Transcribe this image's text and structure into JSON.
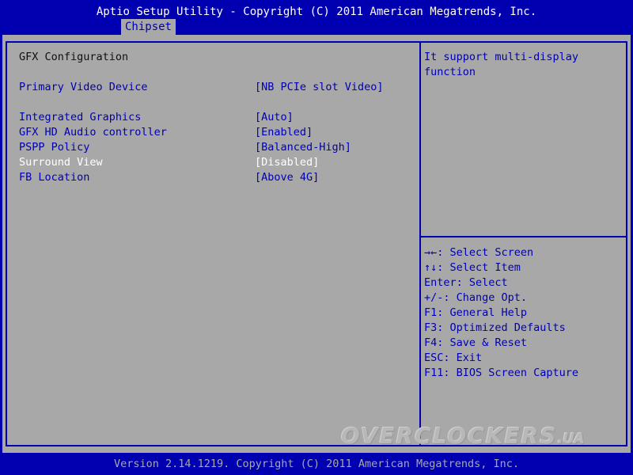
{
  "window": {
    "title": "Aptio Setup Utility - Copyright (C) 2011 American Megatrends, Inc.",
    "active_tab": "Chipset",
    "footer": "Version 2.14.1219. Copyright (C) 2011 American Megatrends, Inc."
  },
  "main": {
    "section_title": "GFX Configuration",
    "settings": [
      {
        "label": "Primary Video Device",
        "value": "[NB PCIe slot Video]",
        "selected": true
      },
      {
        "label": "Integrated Graphics",
        "value": "[Auto]"
      },
      {
        "label": "GFX HD Audio controller",
        "value": "[Enabled]"
      },
      {
        "label": "PSPP Policy",
        "value": "[Balanced-High]"
      },
      {
        "label": "Surround View",
        "value": "[Disabled]",
        "disabled": true
      },
      {
        "label": "FB Location",
        "value": "[Above 4G]"
      }
    ]
  },
  "help": {
    "description": "It support multi-display function",
    "keys": [
      "→←: Select Screen",
      "↑↓: Select Item",
      "Enter: Select",
      "+/-: Change Opt.",
      "F1: General Help",
      "F3: Optimized Defaults",
      "F4: Save & Reset",
      "ESC: Exit",
      "F11: BIOS Screen Capture"
    ]
  },
  "watermark": {
    "main": "OVERCLOCKERS",
    "suffix": ".UA"
  },
  "colors": {
    "background": "#0000b0",
    "panel": "#a8a8a8",
    "selected_text": "#ffffff",
    "static_text": "#101010",
    "interactive_text": "#0000b0"
  }
}
